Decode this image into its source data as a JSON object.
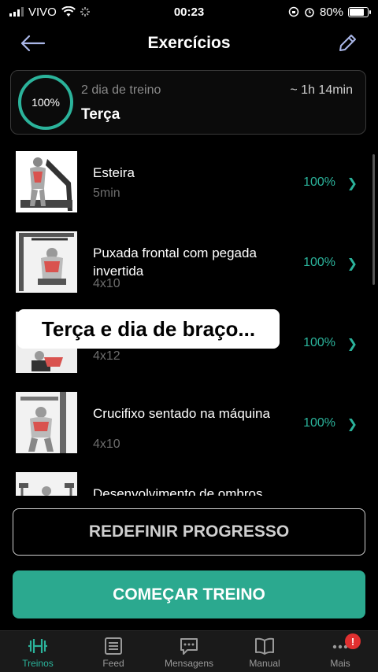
{
  "status": {
    "carrier": "VIVO",
    "time": "00:23",
    "battery": "80%",
    "battery_level": 0.8
  },
  "header": {
    "title": "Exercícios",
    "back_icon": "arrow-left-icon",
    "edit_icon": "pencil-icon"
  },
  "summary": {
    "progress": "100%",
    "day_label": "2 dia de treino",
    "day_name": "Terça",
    "duration": "~ 1h 14min",
    "accent": "#2bb39b"
  },
  "exercises": [
    {
      "name": "Esteira",
      "detail": "5min",
      "progress": "100%"
    },
    {
      "name": "Puxada frontal com pegada invertida",
      "detail": "4x10",
      "progress": "100%"
    },
    {
      "name": "",
      "detail": "4x12",
      "progress": "100%"
    },
    {
      "name": "Crucifixo sentado na máquina",
      "detail": "4x10",
      "progress": "100%"
    },
    {
      "name": "Desenvolvimento de ombros",
      "detail": "",
      "progress": ""
    }
  ],
  "overlay": {
    "text": "Terça e dia de braço..."
  },
  "buttons": {
    "reset": "REDEFINIR PROGRESSO",
    "start": "COMEÇAR TREINO"
  },
  "tabs": [
    {
      "label": "Treinos",
      "icon": "dumbbell-icon"
    },
    {
      "label": "Feed",
      "icon": "feed-icon"
    },
    {
      "label": "Mensagens",
      "icon": "chat-icon"
    },
    {
      "label": "Manual",
      "icon": "book-icon"
    },
    {
      "label": "Mais",
      "icon": "more-icon",
      "badge": "!"
    }
  ]
}
